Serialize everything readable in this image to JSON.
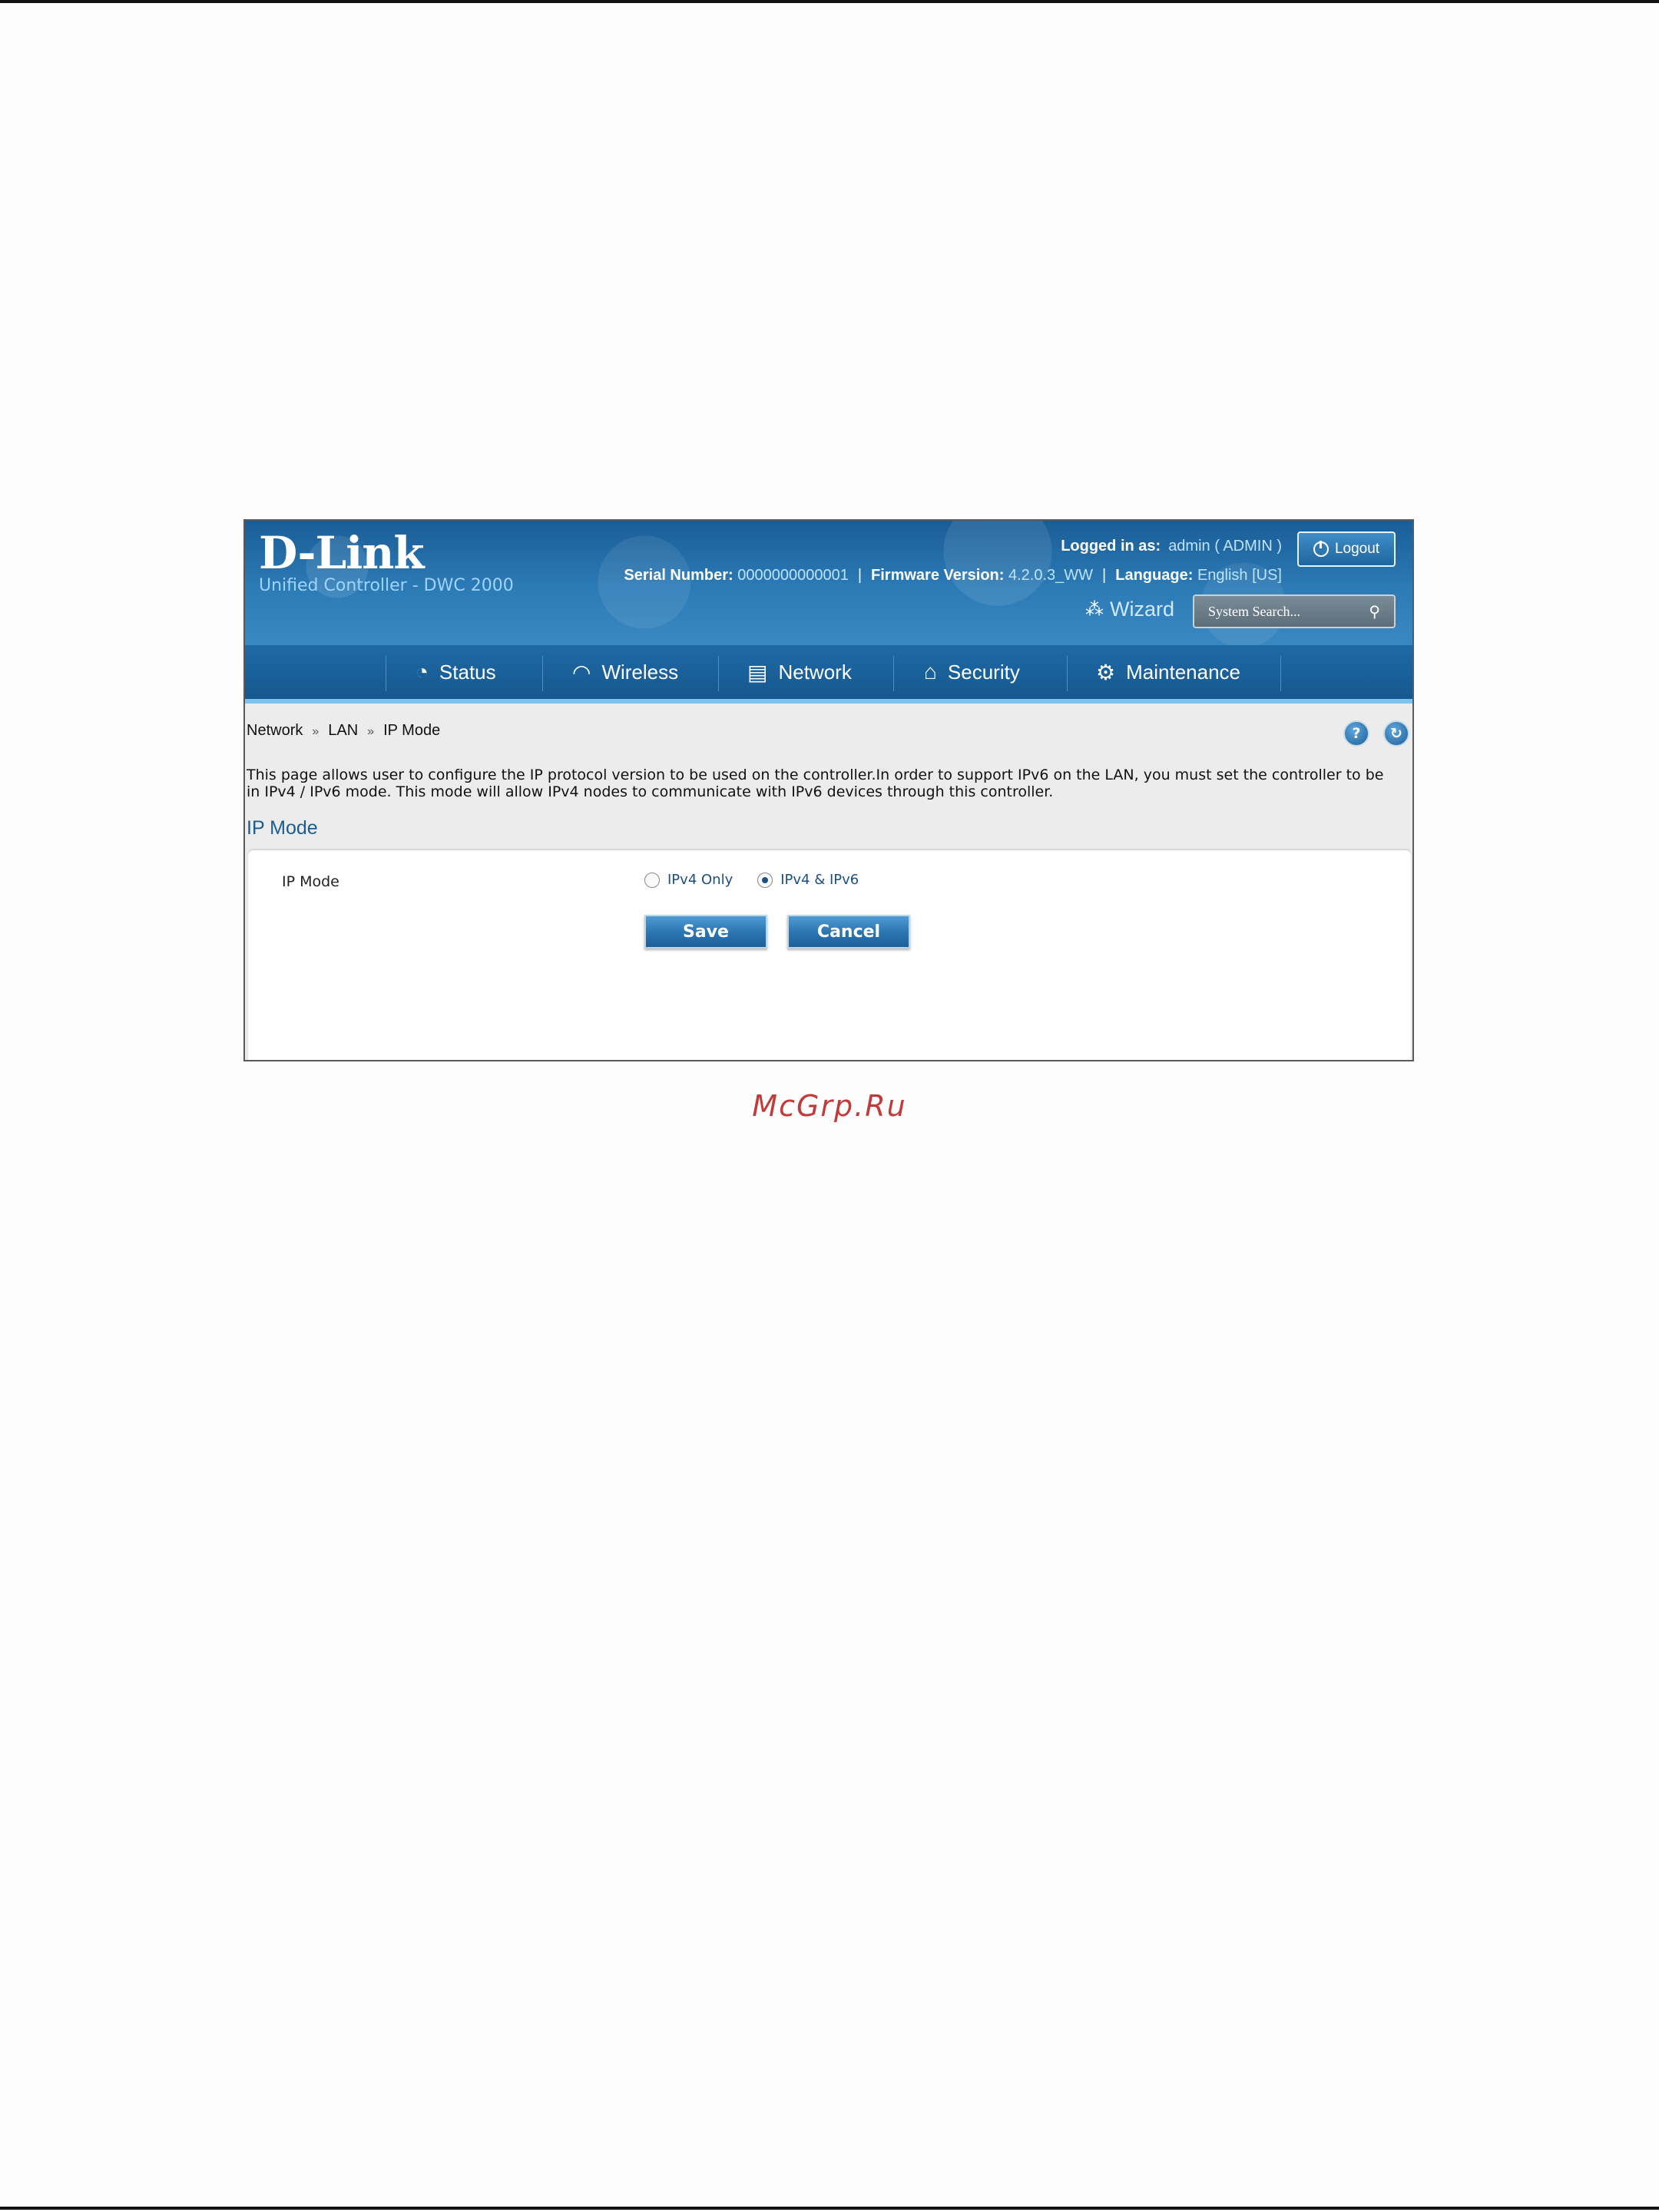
{
  "header": {
    "logo": "D-Link",
    "subtitle": "Unified Controller - DWC 2000",
    "logged_in_label": "Logged in as:",
    "logged_in_value": "admin ( ADMIN )",
    "logout_label": "Logout",
    "serial_label": "Serial Number:",
    "serial_value": "0000000000001",
    "firmware_label": "Firmware Version:",
    "firmware_value": "4.2.0.3_WW",
    "language_label": "Language:",
    "language_value": "English [US]",
    "separator": "|",
    "wizard_label": "Wizard",
    "search_placeholder": "System Search..."
  },
  "nav": {
    "items": [
      {
        "label": "Status",
        "icon": "gauge-icon"
      },
      {
        "label": "Wireless",
        "icon": "wifi-icon"
      },
      {
        "label": "Network",
        "icon": "network-icon"
      },
      {
        "label": "Security",
        "icon": "lock-icon"
      },
      {
        "label": "Maintenance",
        "icon": "gear-icon"
      }
    ]
  },
  "breadcrumb": {
    "items": [
      "Network",
      "LAN",
      "IP Mode"
    ],
    "arrow": "»"
  },
  "description": "This page allows user to configure the IP protocol version to be used on the controller.In order to support IPv6 on the LAN, you must set the controller to be in IPv4 / IPv6 mode. This mode will allow IPv4 nodes to communicate with IPv6 devices through this controller.",
  "section_title": "IP Mode",
  "form": {
    "field_label": "IP Mode",
    "options": [
      {
        "label": "IPv4 Only",
        "selected": false
      },
      {
        "label": "IPv4 & IPv6",
        "selected": true
      }
    ],
    "save_label": "Save",
    "cancel_label": "Cancel"
  },
  "watermark": "McGrp.Ru"
}
